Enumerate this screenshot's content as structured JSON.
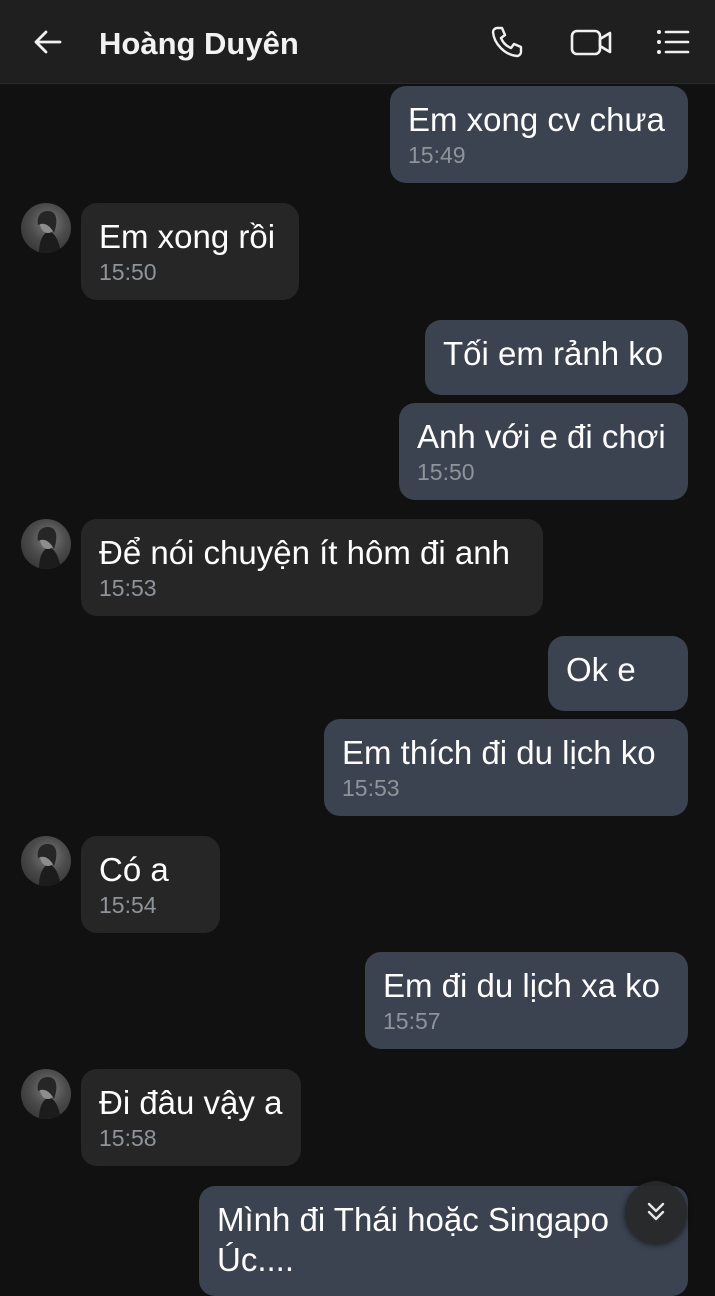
{
  "header": {
    "title": "Hoàng Duyên",
    "back_icon": "arrow-left-icon",
    "call_icon": "phone-icon",
    "video_icon": "video-camera-icon",
    "menu_icon": "list-menu-icon"
  },
  "messages": [
    {
      "dir": "out",
      "text": "Em xong cv chưa",
      "time": "15:49"
    },
    {
      "dir": "in",
      "text": "Em xong rồi",
      "time": "15:50"
    },
    {
      "dir": "out",
      "text": "Tối em rảnh ko",
      "time": ""
    },
    {
      "dir": "out",
      "text": "Anh với e đi chơi",
      "time": "15:50"
    },
    {
      "dir": "in",
      "text": "Để nói chuyện ít hôm đi anh",
      "time": "15:53"
    },
    {
      "dir": "out",
      "text": "Ok e",
      "time": ""
    },
    {
      "dir": "out",
      "text": "Em thích đi du lịch ko",
      "time": "15:53"
    },
    {
      "dir": "in",
      "text": "Có a",
      "time": "15:54"
    },
    {
      "dir": "out",
      "text": "Em đi du lịch xa ko",
      "time": "15:57"
    },
    {
      "dir": "in",
      "text": "Đi đâu vậy a",
      "time": "15:58"
    },
    {
      "dir": "out",
      "text": "Mình đi Thái hoặc Singapo",
      "text2": "Úc....",
      "time": ""
    }
  ],
  "scroll_button_icon": "double-chevron-down-icon",
  "colors": {
    "background": "#111111",
    "header": "#1f1f1f",
    "outgoing_bubble": "#3b4250",
    "incoming_bubble": "#262626",
    "timestamp": "#8f949b"
  }
}
